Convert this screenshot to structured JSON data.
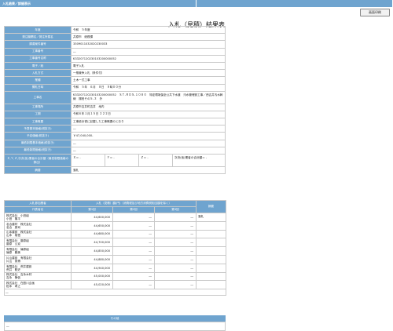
{
  "header": {
    "breadcrumb": "入札結果／詳細表示"
  },
  "toolbar": {
    "print_label": "画面印刷"
  },
  "page": {
    "title": "入札（見積）結果表"
  },
  "details": [
    {
      "label": "年度",
      "value": "令和　５年度"
    },
    {
      "label": "発注機関名／発注所属名",
      "value": "井原市　総務課"
    },
    {
      "label": "調達案件番号",
      "value": "3309011032020230033"
    },
    {
      "label": "工事番号",
      "value": "―"
    },
    {
      "label": "工事番号名称",
      "value": "K33207120230103200000052"
    },
    {
      "label": "電子／紙",
      "value": "電子入札"
    },
    {
      "label": "入札方式",
      "value": "一般競争入札（条件付）"
    },
    {
      "label": "業種",
      "value": "土木一式工事"
    },
    {
      "label": "開札日時",
      "value": "令和　５年　６月　８日　９時００分"
    },
    {
      "label": "工事名",
      "value": "K33207120230103200000052　ＳＴ-ＲＯＳ-１０８０　特定環境保全公共下水道　汚水管埋設工事／西吉井汚水幹線　揚柏その５-３　外"
    },
    {
      "label": "工事場所",
      "value": "井原市吉井町吉井　地内"
    },
    {
      "label": "工期",
      "value": "令和６年１月１５日 ２２２日"
    },
    {
      "label": "工事概要",
      "value": "工事設計書に記載した工事概要のとおり"
    },
    {
      "label": "予算基本価格(税抜き)",
      "value": "―"
    },
    {
      "label": "予定価格(税抜き)",
      "value": "￥47,040,000-"
    },
    {
      "label": "最低制限基本価格(税抜き)",
      "value": "―"
    },
    {
      "label": "最低制限価格(税抜き)",
      "value": "―"
    }
  ],
  "coef": {
    "label": "Ｘ,Ｙ,Ｚ,次決(仮)業者の合計額（最低制限価格の算出）",
    "x": "Ｘ＝ -",
    "y": "Ｙ＝ -",
    "z": "Ｚ＝ -",
    "total": "次決(仮)業者の合計額＝ -"
  },
  "remarks": {
    "label": "摘要",
    "value": "落札"
  },
  "bids": {
    "participants_header": "入札参加業者",
    "amount_header": "入札（見積）額(円)（消費税及び地方消費税相当額を除く）",
    "result_header": "摘要",
    "rep_header": "代表者名",
    "round_headers": [
      "第1回",
      "第2回",
      "第3回"
    ],
    "rows": [
      {
        "company": "株式会社　小田組",
        "rep": "小田　篤平",
        "amounts": [
          "44,600,000",
          "―",
          "―"
        ],
        "result": "落札"
      },
      {
        "company": "名合建材　株式会社",
        "rep": "名合　慶司",
        "amounts": [
          "44,650,000",
          "―",
          "―"
        ],
        "result": ""
      },
      {
        "company": "山本建設　株式会社",
        "rep": "山本　雄悟",
        "amounts": [
          "44,680,000",
          "―",
          "―"
        ],
        "result": ""
      },
      {
        "company": "有限会社　藤原組",
        "rep": "藤原　公克",
        "amounts": [
          "44,700,000",
          "―",
          "―"
        ],
        "result": ""
      },
      {
        "company": "有限会社　篠原組",
        "rep": "篠原　勝美",
        "amounts": [
          "44,850,000",
          "―",
          "―"
        ],
        "result": ""
      },
      {
        "company": "片山建設　有限会社",
        "rep": "片山　貴博",
        "amounts": [
          "44,880,000",
          "―",
          "―"
        ],
        "result": ""
      },
      {
        "company": "有限会社　荒井建設",
        "rep": "荒井　聡史",
        "amounts": [
          "44,940,000",
          "―",
          "―"
        ],
        "result": ""
      },
      {
        "company": "株式会社　吉永木材",
        "rep": "吉永　静信",
        "amounts": [
          "45,000,000",
          "―",
          "―"
        ],
        "result": ""
      },
      {
        "company": "株式会社　在庭川企画",
        "rep": "松本　孝之",
        "amounts": [
          "45,020,000",
          "―",
          "―"
        ],
        "result": ""
      }
    ],
    "footer": "―"
  },
  "other": {
    "header": "その他",
    "value": "―"
  },
  "colors": {
    "accent": "#6fa4cf",
    "border": "#c9c9c9"
  }
}
